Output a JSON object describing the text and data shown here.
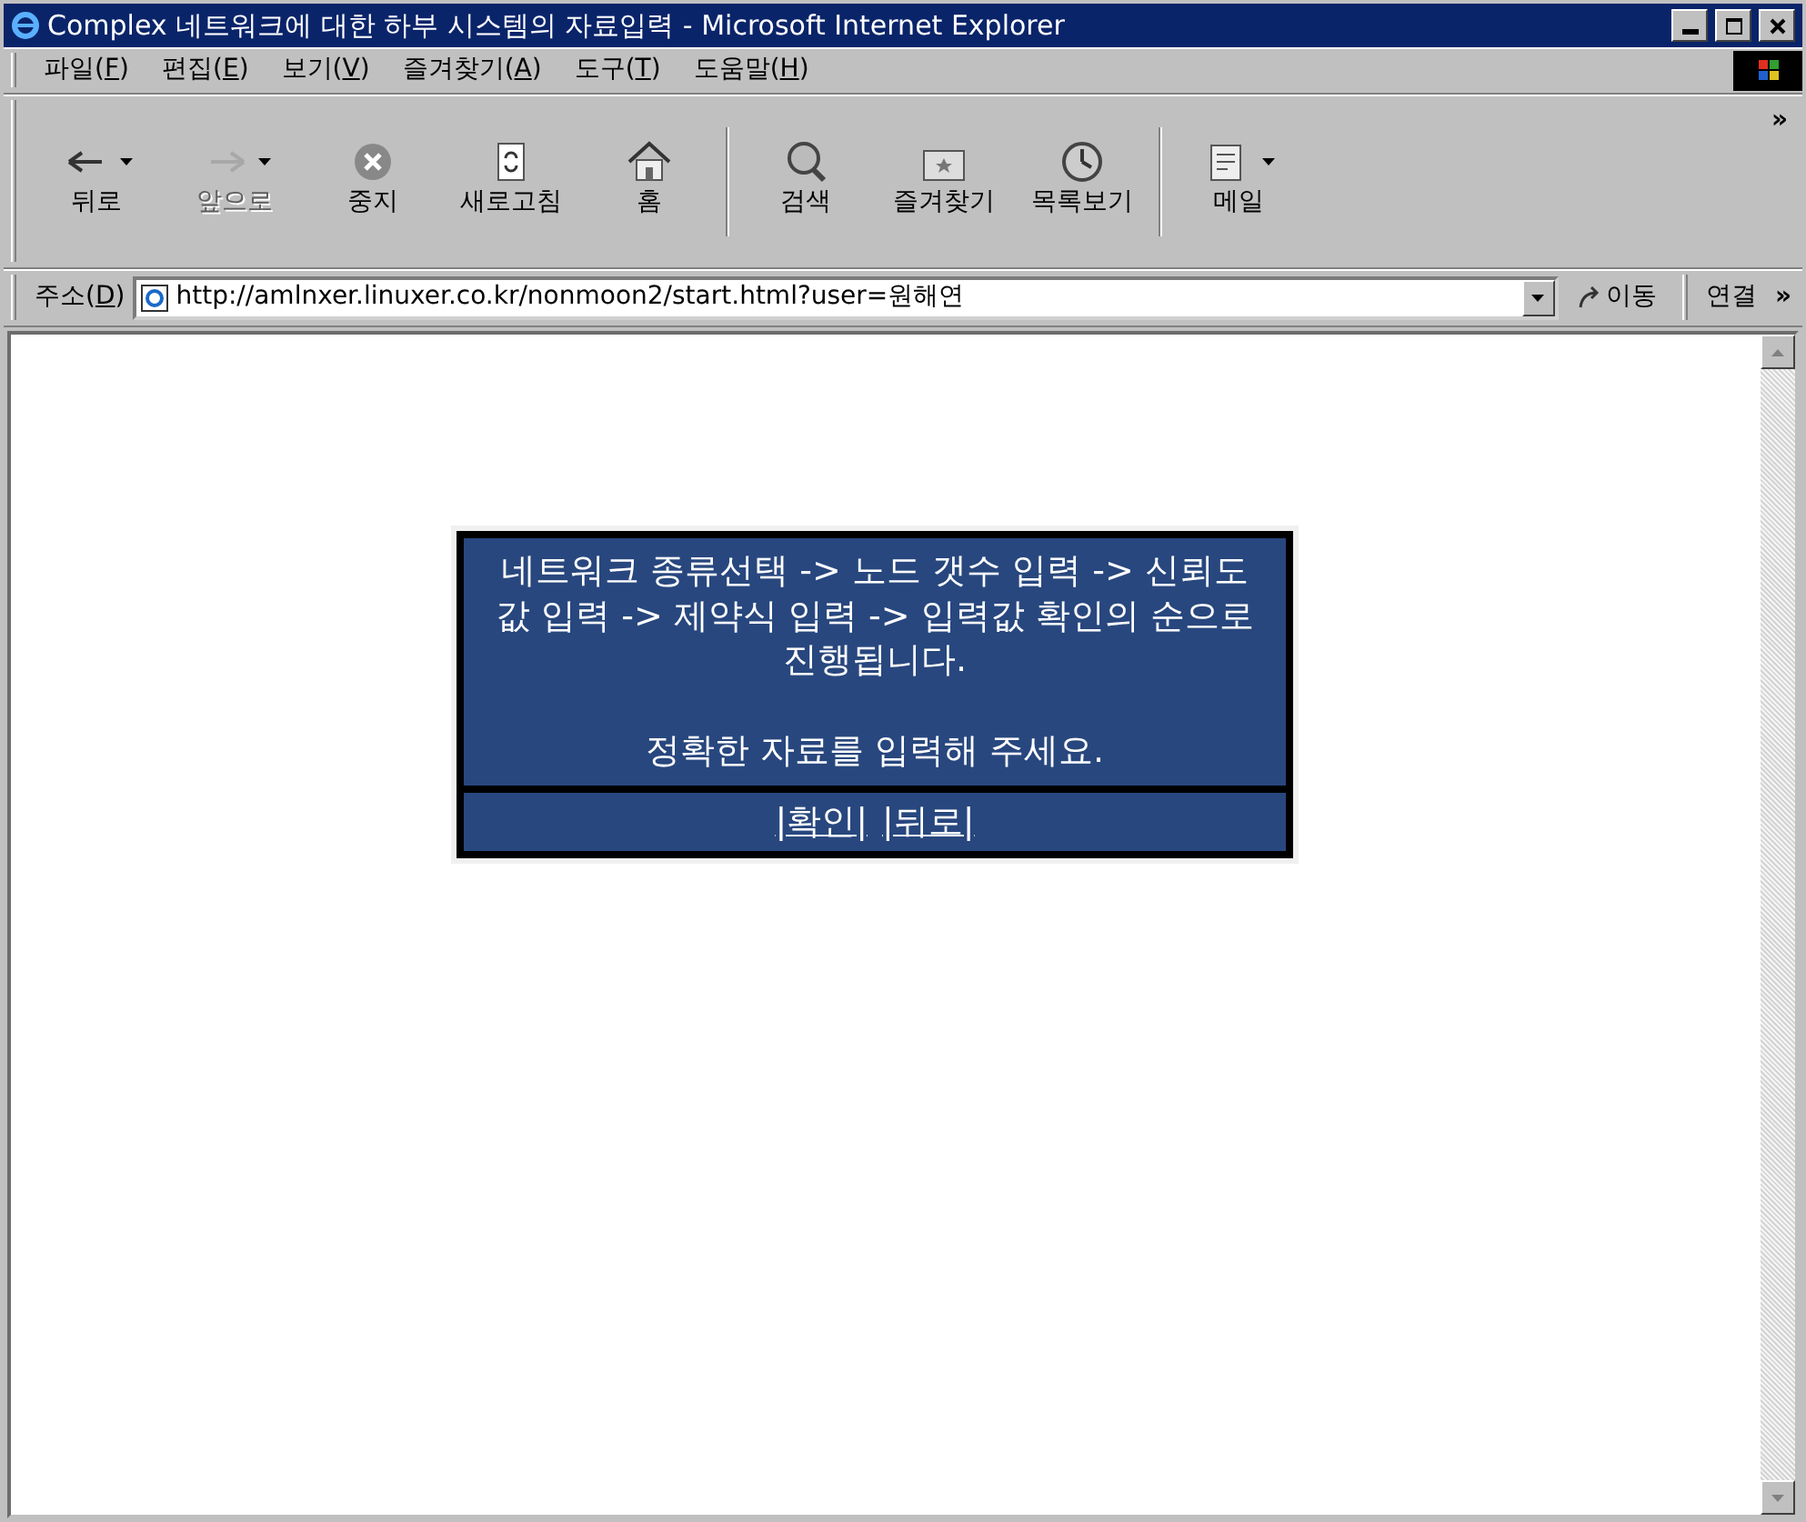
{
  "window": {
    "title": "Complex 네트워크에 대한 하부 시스템의 자료입력 - Microsoft Internet Explorer"
  },
  "menu": [
    {
      "label": "파일(F)"
    },
    {
      "label": "편집(E)"
    },
    {
      "label": "보기(V)"
    },
    {
      "label": "즐겨찾기(A)"
    },
    {
      "label": "도구(T)"
    },
    {
      "label": "도움말(H)"
    }
  ],
  "toolbar": [
    {
      "kind": "back",
      "label": "뒤로",
      "disabled": false,
      "dropdown": true
    },
    {
      "kind": "forward",
      "label": "앞으로",
      "disabled": true,
      "dropdown": true
    },
    {
      "kind": "stop",
      "label": "중지",
      "disabled": false,
      "dropdown": false
    },
    {
      "kind": "refresh",
      "label": "새로고침",
      "disabled": false,
      "dropdown": false
    },
    {
      "kind": "home",
      "label": "홈",
      "disabled": false,
      "dropdown": false
    },
    {
      "kind": "separator"
    },
    {
      "kind": "search",
      "label": "검색",
      "disabled": false,
      "dropdown": false
    },
    {
      "kind": "favorites",
      "label": "즐겨찾기",
      "disabled": false,
      "dropdown": false
    },
    {
      "kind": "history",
      "label": "목록보기",
      "disabled": false,
      "dropdown": false
    },
    {
      "kind": "separator"
    },
    {
      "kind": "mail",
      "label": "메일",
      "disabled": false,
      "dropdown": true
    }
  ],
  "toolbar_more": "»",
  "address": {
    "label": "주소(D)",
    "value": "http://amlnxer.linuxer.co.kr/nonmoon2/start.html?user=원해연",
    "go": "이동",
    "links": "연결",
    "links_more": "»"
  },
  "notice": {
    "message": "네트워크 종류선택 -> 노드 갯수 입력 -> 신뢰도값 입력 -> 제약식 입력 -> 입력값 확인의 순으로 진행됩니다.",
    "note": "정확한 자료를 입력해 주세요.",
    "links": [
      "|확인|",
      "|뒤로|"
    ]
  }
}
